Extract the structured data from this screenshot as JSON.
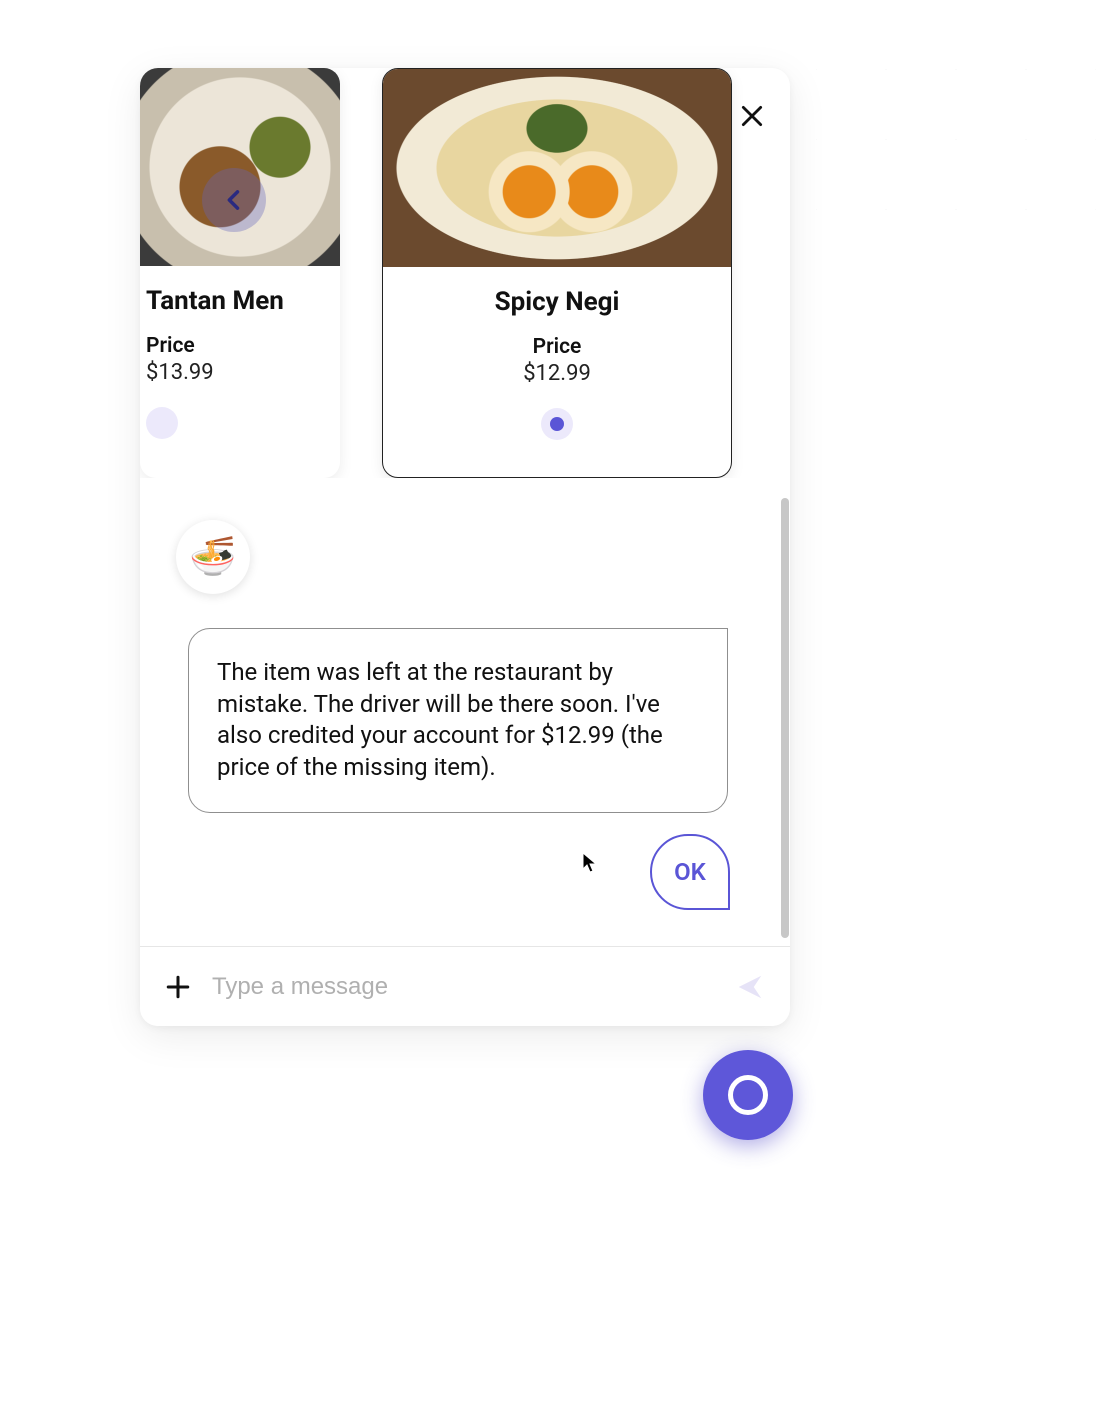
{
  "carousel": {
    "items": [
      {
        "title": "Tantan Men",
        "price_label": "Price",
        "price_value": "$13.99",
        "selected": false
      },
      {
        "title": "Spicy Negi",
        "price_label": "Price",
        "price_value": "$12.99",
        "selected": true
      }
    ]
  },
  "avatar_emoji": "🍜",
  "message": "The item was left at the restaurant by mistake. The driver will be there soon. I've also credited your account for $12.99 (the price of the missing item).",
  "ok_label": "OK",
  "input": {
    "placeholder": "Type a message",
    "value": ""
  },
  "colors": {
    "accent": "#5a55d6"
  }
}
